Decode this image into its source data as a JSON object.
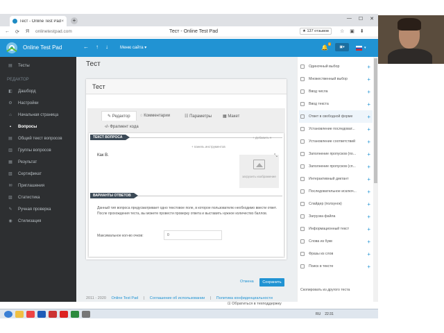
{
  "browser": {
    "tab_title": "Тест - Online Test Pad",
    "tab_close": "×",
    "new_tab": "+",
    "url": "onlinetestpad.com",
    "page_title": "Тест - Online Test Pad",
    "reviews": "★ 137 отзывов",
    "win_controls": [
      "—",
      "☐",
      "✕"
    ],
    "nav_icons": [
      "←",
      "⟳",
      "Я"
    ],
    "right_icons": [
      "☆",
      "▣",
      "⬇"
    ]
  },
  "header": {
    "logo_text": "Online Test Pad",
    "nav": [
      "←",
      "↑",
      "↓"
    ],
    "menu": "Меню сайта ▾",
    "badge": "1",
    "bell": "🔔",
    "flag_drop": "▾"
  },
  "sidebar": {
    "top_item": {
      "icon": "▤",
      "label": "Тесты"
    },
    "section": "РЕДАКТОР",
    "items": [
      {
        "icon": "◧",
        "label": "Дашборд"
      },
      {
        "icon": "⚙",
        "label": "Настройки"
      },
      {
        "icon": "⌂",
        "label": "Начальная страница"
      },
      {
        "icon": "▪",
        "label": "Вопросы"
      },
      {
        "icon": "▤",
        "label": "Общий текст вопросов"
      },
      {
        "icon": "▥",
        "label": "Группы вопросов"
      },
      {
        "icon": "▦",
        "label": "Результат"
      },
      {
        "icon": "▧",
        "label": "Сертификат"
      },
      {
        "icon": "✉",
        "label": "Приглашения"
      },
      {
        "icon": "▨",
        "label": "Статистика"
      },
      {
        "icon": "✎",
        "label": "Ручная проверка"
      },
      {
        "icon": "◉",
        "label": "Стилизация"
      }
    ]
  },
  "main": {
    "page_title": "Тест",
    "card_title": "Тест",
    "tabs": [
      {
        "icon": "✎",
        "label": "Редактор"
      },
      {
        "icon": "◌",
        "label": "Комментарии"
      },
      {
        "icon": "☷",
        "label": "Параметры"
      },
      {
        "icon": "▦",
        "label": "Макет"
      },
      {
        "icon": "‹/›",
        "label": "Фрагмент кода"
      }
    ],
    "question_section": "ТЕКСТ ВОПРОСА",
    "add_link": "+ Добавить ▾",
    "toolbar_link": "+ панель инструментов",
    "question_text": "Как В.",
    "upload_label": "загрузить изображение",
    "answers_section": "ВАРИАНТЫ ОТВЕТОВ",
    "description": "Данный тип вопроса предусматривает одно текстовое поле, в которое пользователю необходимо ввести ответ. После прохождения теста, вы можете провести проверку ответа и выставить нужное количество баллов.",
    "max_score_label": "Максимальное кол-во очков:",
    "max_score_value": "0",
    "cancel": "Отмена",
    "save": "Сохранить"
  },
  "footer": {
    "years": "2011 - 2020",
    "links": [
      "Online Test Pad",
      "Соглашение об использовании",
      "Политика конфиденциальности"
    ],
    "support": "⊡ Обратиться в техподдержку"
  },
  "rpanel": {
    "items": [
      "Одиночный выбор",
      "Множественный выбор",
      "Ввод числа",
      "Ввод текста",
      "Ответ в свободной форме",
      "Установление последоват...",
      "Установление соответствий",
      "Заполнение пропусков (по...",
      "Заполнение пропусков (сп...",
      "Интерактивный диктант",
      "Последовательное исключ...",
      "Слайдер (ползунок)",
      "Загрузка файла",
      "Информационный текст",
      "Слова из букв",
      "Фразы из слов",
      "Поиск в тексте"
    ],
    "add": "+",
    "copy": "Скопировать из другого теста"
  },
  "taskbar": {
    "lang": "RU",
    "time": "22:31"
  },
  "colors": {
    "accent": "#2193d3",
    "sidebar": "#2d2f31",
    "section_header": "#3c4a57"
  }
}
